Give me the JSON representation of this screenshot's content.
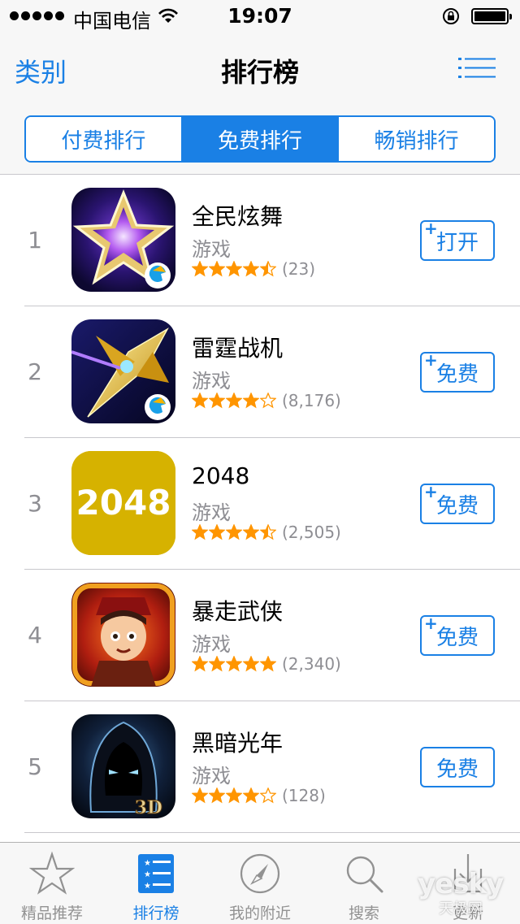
{
  "status_bar": {
    "carrier": "中国电信",
    "time": "19:07"
  },
  "nav": {
    "back_label": "类别",
    "title": "排行榜",
    "list_icon": "list-icon"
  },
  "segments": [
    {
      "label": "付费排行",
      "active": false
    },
    {
      "label": "免费排行",
      "active": true
    },
    {
      "label": "畅销排行",
      "active": false
    }
  ],
  "apps": [
    {
      "rank": "1",
      "name": "全民炫舞",
      "category": "游戏",
      "rating": 4.5,
      "reviews": "(23)",
      "button": "打开",
      "plus": true,
      "icon": "star-dance-icon"
    },
    {
      "rank": "2",
      "name": "雷霆战机",
      "category": "游戏",
      "rating": 4,
      "reviews": "(8,176)",
      "button": "免费",
      "plus": true,
      "icon": "fighter-jet-icon"
    },
    {
      "rank": "3",
      "name": "2048",
      "category": "游戏",
      "rating": 4.5,
      "reviews": "(2,505)",
      "button": "免费",
      "plus": true,
      "icon": "2048-icon",
      "icon_text": "2048"
    },
    {
      "rank": "4",
      "name": "暴走武侠",
      "category": "游戏",
      "rating": 5,
      "reviews": "(2,340)",
      "button": "免费",
      "plus": true,
      "icon": "warrior-icon"
    },
    {
      "rank": "5",
      "name": "黑暗光年",
      "category": "游戏",
      "rating": 4,
      "reviews": "(128)",
      "button": "免费",
      "plus": false,
      "icon": "dark-hood-icon",
      "icon_badge": "3D"
    }
  ],
  "tabs": [
    {
      "label": "精品推荐",
      "icon": "star-icon",
      "active": false
    },
    {
      "label": "排行榜",
      "icon": "ranking-list-icon",
      "active": true
    },
    {
      "label": "我的附近",
      "icon": "compass-icon",
      "active": false
    },
    {
      "label": "搜索",
      "icon": "search-icon",
      "active": false
    },
    {
      "label": "更新",
      "icon": "download-icon",
      "active": false
    }
  ],
  "watermark": {
    "text": "yesky",
    "sub": "天极网"
  },
  "colors": {
    "accent": "#1a80e5",
    "star": "#ff9500",
    "separator": "#c8c7cc"
  }
}
